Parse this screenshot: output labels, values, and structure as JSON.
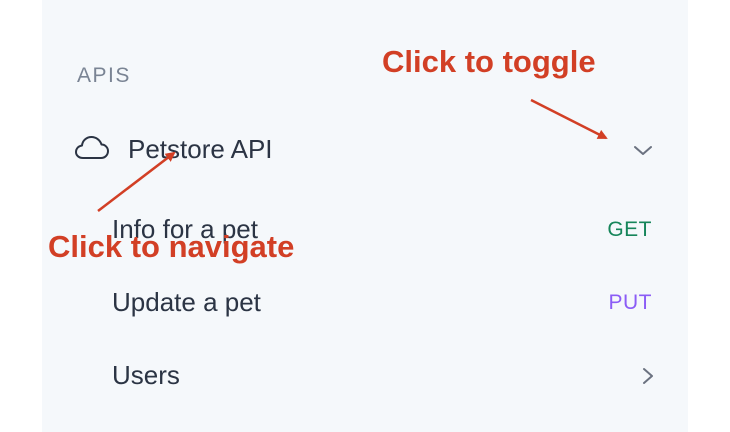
{
  "sidebar": {
    "section_title": "APIS",
    "group": {
      "label": "Petstore API",
      "icon": "cloud-icon",
      "toggle_icon": "chevron-down-icon",
      "expanded": true
    },
    "items": [
      {
        "label": "Info for a pet",
        "method": "GET",
        "method_color": "#16855a"
      },
      {
        "label": "Update a pet",
        "method": "PUT",
        "method_color": "#8b5cf6"
      },
      {
        "label": "Users",
        "icon": "chevron-right-icon"
      }
    ]
  },
  "annotations": {
    "toggle": "Click to toggle",
    "navigate": "Click to navigate",
    "color": "#d23f25"
  }
}
